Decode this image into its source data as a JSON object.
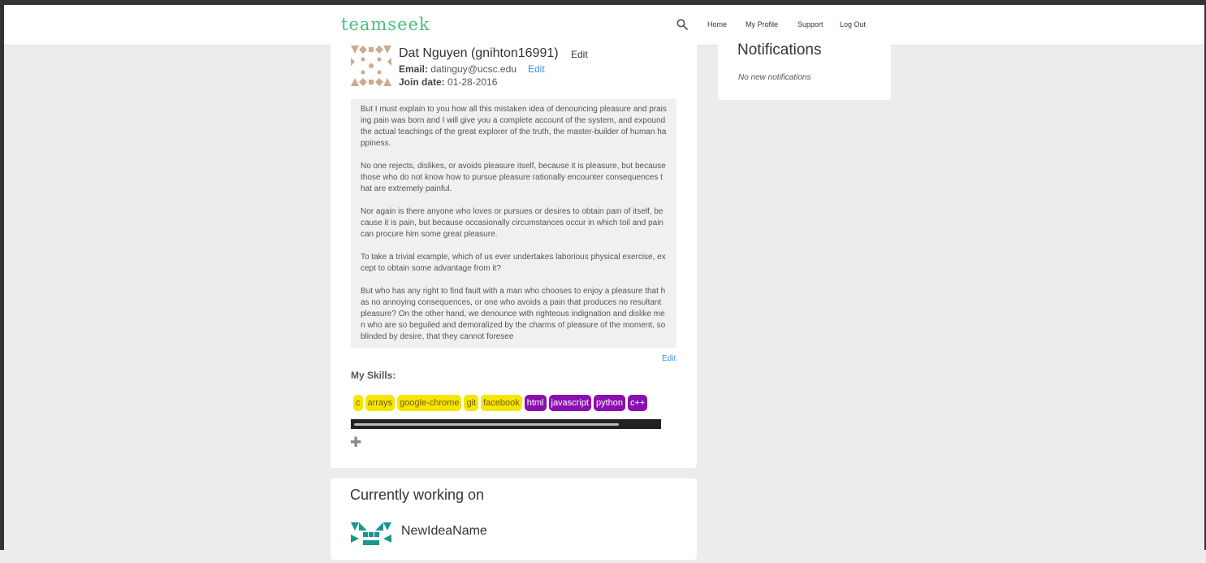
{
  "navbar": {
    "brand": "teamseek",
    "links": [
      "Home",
      "My Profile",
      "Support",
      "Log Out"
    ]
  },
  "profile": {
    "name": "Dat Nguyen (gnihton16991)",
    "edit_label": "Edit",
    "email_label": "Email:",
    "email": "datinguy@ucsc.edu",
    "email_edit_label": "Edit",
    "join_label": "Join date:",
    "join_date": "01-28-2016",
    "bio": [
      "But I must explain to you how all this mistaken idea of denouncing pleasure and praising pain was born and I will give you a complete account of the system, and expound the actual teachings of the great explorer of the truth, the master-builder of human happiness.",
      "No one rejects, dislikes, or avoids pleasure itself, because it is pleasure, but because those who do not know how to pursue pleasure rationally encounter consequences that are extremely painful.",
      "Nor again is there anyone who loves or pursues or desires to obtain pain of itself, because it is pain, but because occasionally circumstances occur in which toil and pain can procure him some great pleasure.",
      "To take a trivial example, which of us ever undertakes laborious physical exercise, except to obtain some advantage from it?",
      "But who has any right to find fault with a man who chooses to enjoy a pleasure that has no annoying consequences, or one who avoids a pain that produces no resultant pleasure? On the other hand, we denounce with righteous indignation and dislike men who are so beguiled and demoralized by the charms of pleasure of the moment, so blinded by desire, that they cannot foresee"
    ],
    "bio_edit_label": "Edit",
    "skills_title": "My Skills:",
    "skills": [
      {
        "label": "c",
        "color": "#f5e600",
        "text_color": "#7a5a00"
      },
      {
        "label": "arrays",
        "color": "#f5e600",
        "text_color": "#7a5a00"
      },
      {
        "label": "google-chrome",
        "color": "#f5e600",
        "text_color": "#7a5a00"
      },
      {
        "label": "git",
        "color": "#f5e600",
        "text_color": "#7a5a00"
      },
      {
        "label": "facebook",
        "color": "#f5e600",
        "text_color": "#7a5a00"
      },
      {
        "label": "html",
        "color": "#8a0fb0",
        "text_color": "#ffffff"
      },
      {
        "label": "javascript",
        "color": "#8a0fb0",
        "text_color": "#ffffff"
      },
      {
        "label": "python",
        "color": "#8a0fb0",
        "text_color": "#ffffff"
      },
      {
        "label": "c++",
        "color": "#8a0fb0",
        "text_color": "#ffffff"
      }
    ],
    "add_skill_icon": "plus-icon"
  },
  "working_on": {
    "title": "Currently working on",
    "projects": [
      {
        "name": "NewIdeaName"
      }
    ]
  },
  "notifications": {
    "title": "Notifications",
    "empty_text": "No new notifications"
  },
  "colors": {
    "brand": "#4cc07d",
    "link": "#3a8fd6",
    "skill_yellow": "#f5e600",
    "skill_purple": "#8a0fb0",
    "avatar_profile": "#c9ab8e",
    "avatar_project": "#17978f"
  }
}
